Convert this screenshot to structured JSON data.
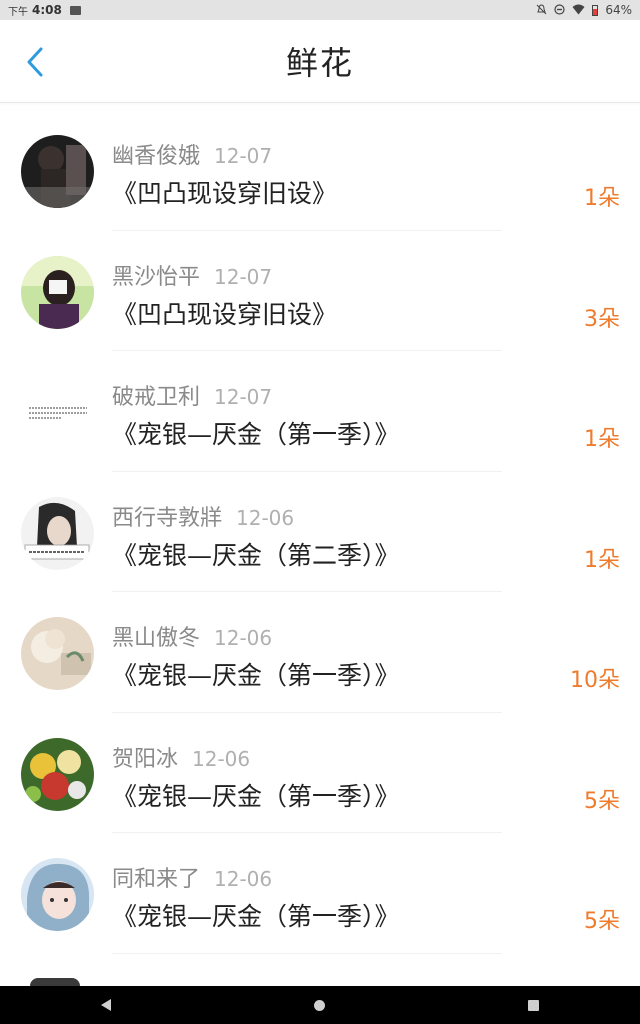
{
  "status_bar": {
    "ampm": "下午",
    "time": "4:08",
    "battery": "64%",
    "icons": [
      "image-icon",
      "notifications-off-icon",
      "do-not-disturb-icon",
      "wifi-icon",
      "battery-icon"
    ]
  },
  "header": {
    "title": "鲜花",
    "back_icon": "chevron-left-icon",
    "accent_color": "#2f9ae0"
  },
  "colors": {
    "count": "#ef7b2c",
    "name": "#8a8a8a",
    "date": "#b0b0b0"
  },
  "list": [
    {
      "name": "幽香俊娥",
      "date": "12-07",
      "book": "《凹凸现设穿旧设》",
      "count": "1朵"
    },
    {
      "name": "黑沙怡平",
      "date": "12-07",
      "book": "《凹凸现设穿旧设》",
      "count": "3朵"
    },
    {
      "name": "破戒卫利",
      "date": "12-07",
      "book": "《宠银—厌金（第一季）》",
      "count": "1朵"
    },
    {
      "name": "西行寺敦牂",
      "date": "12-06",
      "book": "《宠银—厌金（第二季）》",
      "count": "1朵"
    },
    {
      "name": "黑山傲冬",
      "date": "12-06",
      "book": "《宠银—厌金（第一季）》",
      "count": "10朵"
    },
    {
      "name": "贺阳冰",
      "date": "12-06",
      "book": "《宠银—厌金（第一季）》",
      "count": "5朵"
    },
    {
      "name": "同和来了",
      "date": "12-06",
      "book": "《宠银—厌金（第一季）》",
      "count": "5朵"
    }
  ],
  "nav_bar": {
    "icons": [
      "back-triangle-icon",
      "home-circle-icon",
      "recents-square-icon"
    ]
  }
}
